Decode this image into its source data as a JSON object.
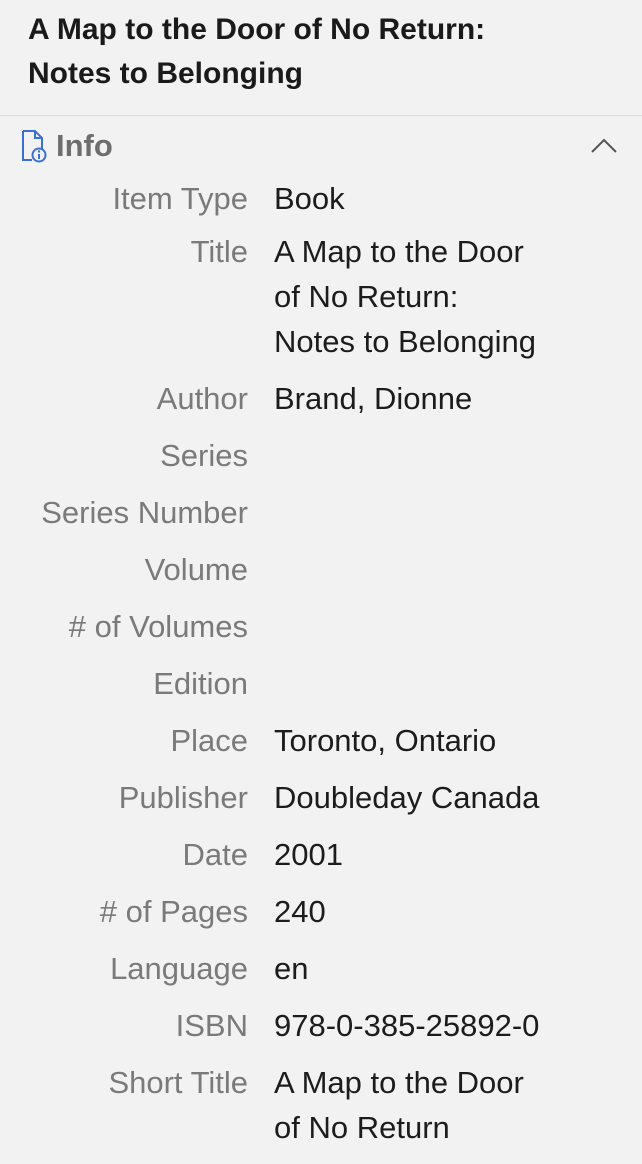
{
  "header": {
    "title_line1": "A Map to the Door of No Return:",
    "title_line2": "Notes to Belonging"
  },
  "section": {
    "title": "Info",
    "icon": "document-info-icon",
    "collapse_icon": "chevron-up-icon"
  },
  "fields": {
    "item_type": {
      "label": "Item Type",
      "value": "Book"
    },
    "title": {
      "label": "Title",
      "line1": "A Map to the Door",
      "line2": "of No Return:",
      "line3": "Notes to Belonging"
    },
    "author": {
      "label": "Author",
      "value": "Brand, Dionne"
    },
    "series": {
      "label": "Series",
      "value": ""
    },
    "series_number": {
      "label": "Series Number",
      "value": ""
    },
    "volume": {
      "label": "Volume",
      "value": ""
    },
    "num_volumes": {
      "label": "# of Volumes",
      "value": ""
    },
    "edition": {
      "label": "Edition",
      "value": ""
    },
    "place": {
      "label": "Place",
      "value": "Toronto, Ontario"
    },
    "publisher": {
      "label": "Publisher",
      "value": "Doubleday Canada"
    },
    "date": {
      "label": "Date",
      "value": "2001"
    },
    "num_pages": {
      "label": "# of Pages",
      "value": "240"
    },
    "language": {
      "label": "Language",
      "value": "en"
    },
    "isbn": {
      "label": "ISBN",
      "value": "978-0-385-25892-0"
    },
    "short_title": {
      "label": "Short Title",
      "line1": "A Map to the Door",
      "line2": "of No Return"
    }
  },
  "colors": {
    "background": "#f2f2f2",
    "label": "#7a7a7a",
    "value": "#1c1c1c",
    "icon_accent": "#3b6fd6"
  }
}
